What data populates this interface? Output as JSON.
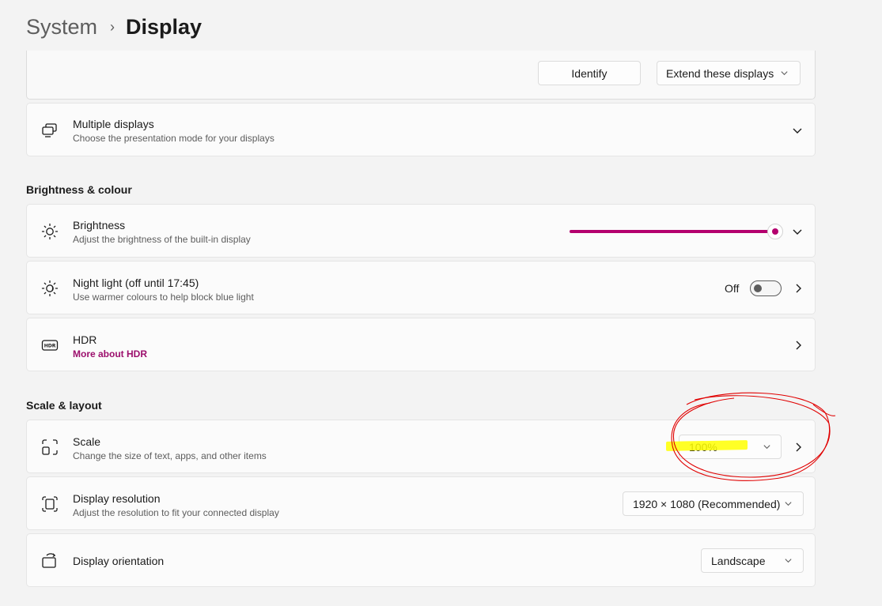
{
  "breadcrumb": {
    "parent": "System",
    "separator": "›",
    "current": "Display"
  },
  "top_card": {
    "identify_label": "Identify",
    "extend_label": "Extend these displays"
  },
  "multiple_displays": {
    "title": "Multiple displays",
    "desc": "Choose the presentation mode for your displays",
    "icon": "multiple-displays-icon"
  },
  "brightness_section": "Brightness & colour",
  "brightness": {
    "title": "Brightness",
    "desc": "Adjust the brightness of the built-in display",
    "value_percent": 100,
    "accent": "#b4006e"
  },
  "night_light": {
    "title": "Night light (off until 17:45)",
    "desc": "Use warmer colours to help block blue light",
    "state_label": "Off",
    "on": false
  },
  "hdr": {
    "title": "HDR",
    "link": "More about HDR"
  },
  "scale_section": "Scale & layout",
  "scale": {
    "title": "Scale",
    "desc": "Change the size of text, apps, and other items",
    "value": "100%"
  },
  "resolution": {
    "title": "Display resolution",
    "desc": "Adjust the resolution to fit your connected display",
    "value": "1920 × 1080 (Recommended)"
  },
  "orientation": {
    "title": "Display orientation",
    "value": "Landscape"
  },
  "annotations": {
    "highlight_color": "#ffff00",
    "circle_color": "#e00000"
  }
}
